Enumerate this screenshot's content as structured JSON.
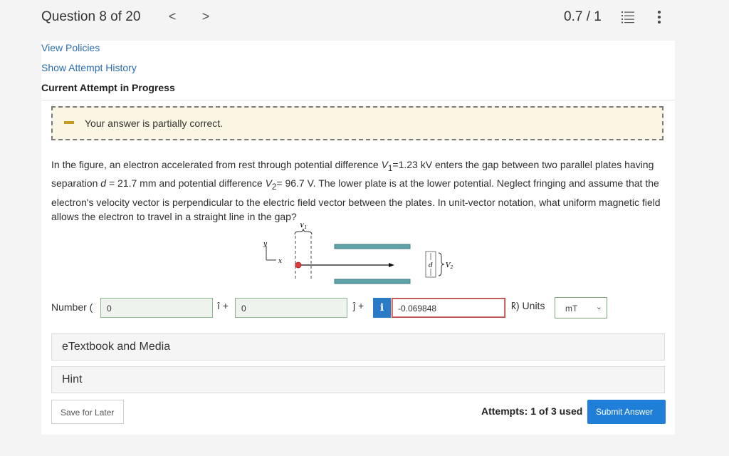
{
  "header": {
    "question_counter": "Question 8 of 20",
    "prev_symbol": "<",
    "next_symbol": ">",
    "score": "0.7 / 1",
    "list_icon": "list-icon",
    "more_icon": "vertical-ellipsis-icon"
  },
  "links": {
    "view_policies": "View Policies",
    "show_attempt_history": "Show Attempt History"
  },
  "attempt": {
    "title": "Current Attempt in Progress"
  },
  "feedback": {
    "message": "Your answer is partially correct.",
    "accent_color": "#c69a2a"
  },
  "problem": {
    "p1": "In the figure, an electron accelerated from rest through potential difference ",
    "v1_sym": "V",
    "v1_sub": "1",
    "p2": "=1.23 kV enters the gap between two parallel plates having separation ",
    "d_sym": "d",
    "p3": " = 21.7 mm and potential difference ",
    "v2_sym": "V",
    "v2_sub": "2",
    "p4": "= 96.7 V. The lower plate is at the lower potential. Neglect fringing and assume that the electron's velocity vector is perpendicular to the electric field vector between the plates. In unit-vector notation, what uniform magnetic field allows the electron to travel in a straight line in the gap?"
  },
  "figure": {
    "y_label": "y",
    "x_label": "x",
    "v1_label": "V",
    "v1_sub": "1",
    "d_label": "d",
    "v2_label": "V",
    "v2_sub": "2",
    "plate_color": "#5fa3a8",
    "electron_color": "#e03a3a"
  },
  "answer": {
    "number_label": "Number (",
    "i_field_value": "0",
    "i_hat": "î +",
    "j_field_value": "0",
    "j_hat": "ĵ +",
    "info_badge": "i",
    "k_field_value": "-0.069848",
    "k_hat_units": "k̂) Units",
    "units_value": "mT"
  },
  "accordions": {
    "etextbook": "eTextbook and Media",
    "hint": "Hint"
  },
  "footer": {
    "save_label": "Save for Later",
    "attempts_text": "Attempts: 1 of 3 used",
    "submit_label": "Submit Answer",
    "submit_color": "#1f7fd8"
  }
}
